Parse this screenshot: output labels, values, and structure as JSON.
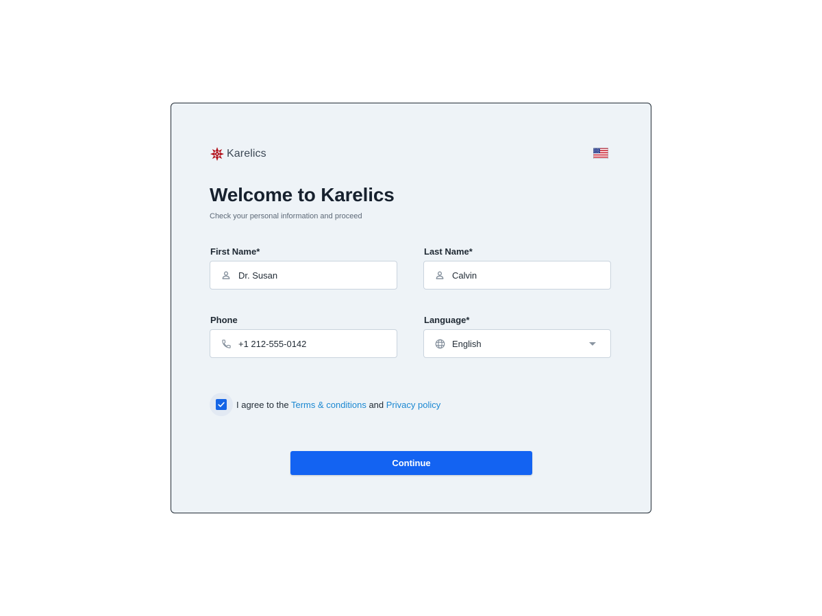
{
  "brand": {
    "name": "Karelics",
    "logo_icon": "karelics-star-logo",
    "logo_color": "#b3141e"
  },
  "language_flag": {
    "icon": "us-flag-icon"
  },
  "header": {
    "title": "Welcome to Karelics",
    "subtitle": "Check your personal information and proceed"
  },
  "form": {
    "first_name": {
      "label": "First Name*",
      "value": "Dr. Susan",
      "icon": "person-icon"
    },
    "last_name": {
      "label": "Last Name*",
      "value": "Calvin",
      "icon": "person-icon"
    },
    "phone": {
      "label": "Phone",
      "value": "+1 212-555-0142",
      "icon": "phone-icon"
    },
    "language": {
      "label": "Language*",
      "selected": "English",
      "icon": "globe-icon"
    },
    "agreement": {
      "checked": true,
      "text_prefix": "I agree to the ",
      "terms_link": "Terms & conditions",
      "text_middle": " and ",
      "privacy_link": "Privacy policy"
    },
    "continue_label": "Continue"
  },
  "colors": {
    "primary": "#1363f2",
    "link": "#1a87d1",
    "card_background": "#eef3f7"
  }
}
